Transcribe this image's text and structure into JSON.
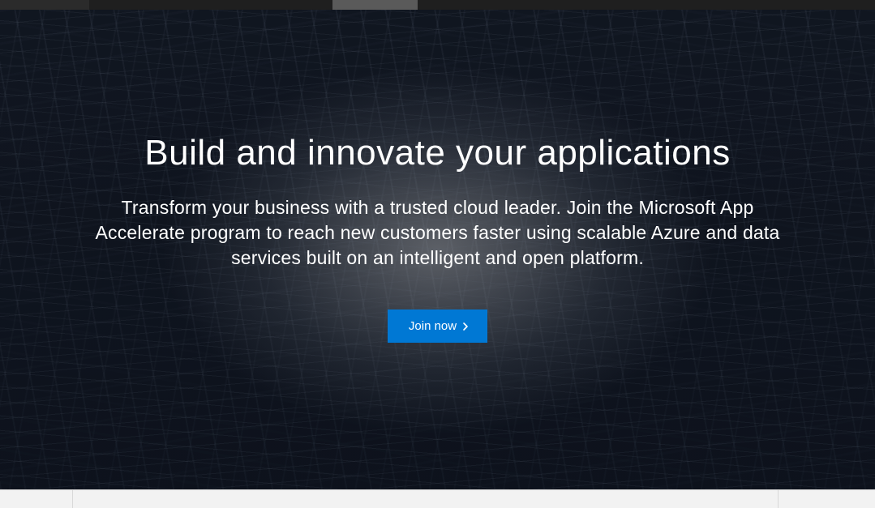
{
  "hero": {
    "title": "Build and innovate your applications",
    "subtitle": "Transform your business with a trusted cloud leader. Join the Microsoft App Accelerate program to reach new customers faster using scalable Azure and data services built on an intelligent and open platform.",
    "cta_label": "Join now"
  },
  "colors": {
    "primary_button": "#0078d4",
    "text_on_dark": "#ffffff"
  }
}
